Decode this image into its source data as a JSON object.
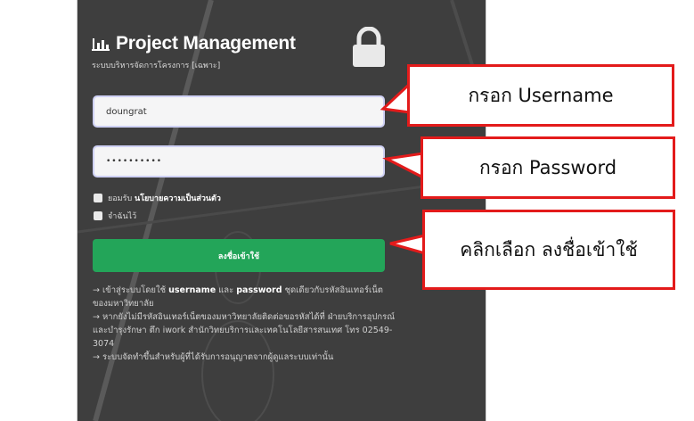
{
  "app": {
    "title": "Project Management",
    "subtitle": "ระบบบริหารจัดการโครงการ [เฉพาะ]"
  },
  "form": {
    "username_value": "doungrat",
    "password_value": "••••••••••",
    "checkbox_privacy_prefix": "ยอมรับ",
    "checkbox_privacy_link": "นโยบายความเป็นส่วนตัว",
    "checkbox_remember": "จำฉันไว้",
    "login_button": "ลงชื่อเข้าใช้"
  },
  "notes": {
    "line1_prefix": "→ เข้าสู่ระบบโดยใช้ ",
    "line1_username": "username",
    "line1_and": " และ ",
    "line1_password": "password",
    "line1_suffix": " ชุดเดียวกับรหัสอินเทอร์เน็ตของมหาวิทยาลัย",
    "line2": "→ หากยังไม่มีรหัสอินเทอร์เน็ตของมหาวิทยาลัยติดต่อขอรหัสได้ที่ ฝ่ายบริการอุปกรณ์และบำรุงรักษา ตึก iwork สำนักวิทยบริการและเทคโนโลยีสารสนเทศ โทร 02549-3074",
    "line3": "→ ระบบจัดทำขึ้นสำหรับผู้ที่ได้รับการอนุญาตจากผู้ดูแลระบบเท่านั้น"
  },
  "callouts": {
    "username": "กรอก Username",
    "password": "กรอก Password",
    "login": "คลิกเลือก ลงชื่อเข้าใช้"
  },
  "colors": {
    "panel_bg": "#3e3e3e",
    "login_button_bg": "#23a559",
    "callout_border": "#e31b1b"
  },
  "icons": {
    "brand": "bar-chart-icon",
    "lock": "lock-icon"
  }
}
